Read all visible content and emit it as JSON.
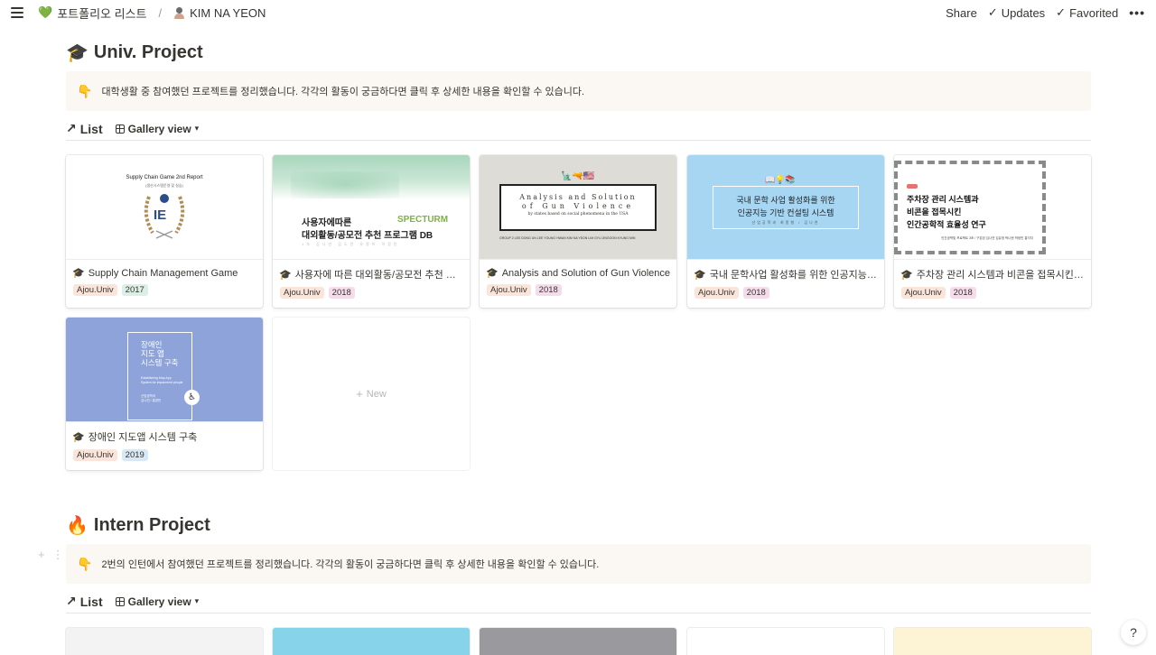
{
  "topbar": {
    "breadcrumb_1": "포트폴리오 리스트",
    "breadcrumb_2": "KIM NA YEON",
    "share": "Share",
    "updates": "Updates",
    "favorited": "Favorited",
    "more": "•••"
  },
  "sections": [
    {
      "emoji": "🎓",
      "title": "Univ. Project",
      "callout_emoji": "👇",
      "callout": "대학생활 중 참여했던 프로젝트를 정리했습니다. 각각의 활동이 궁금하다면 클릭 후 상세한 내용을 확인할 수 있습니다.",
      "view_link": "List",
      "view_type": "Gallery view"
    },
    {
      "emoji": "🔥",
      "title": "Intern Project",
      "callout_emoji": "👇",
      "callout": "2번의 인턴에서 참여했던 프로젝트를 정리했습니다. 각각의 활동이 궁금하다면 클릭 후 상세한 내용을 확인할 수 있습니다.",
      "view_link": "List",
      "view_type": "Gallery view"
    }
  ],
  "cards": [
    {
      "title": "Supply Chain Management Game",
      "tag": "Ajou.Univ",
      "year": "2017",
      "thumb": {
        "h": "Supply Chain Game 2nd Report",
        "s": "(생산시스템운영 및 실습)",
        "logo": "IE"
      }
    },
    {
      "title": "사용자에 따른 대외활동/공모전 추천 프로그램 DB",
      "tag": "Ajou.Univ",
      "year": "2018",
      "thumb": {
        "l1": "사용자에따른",
        "l2": "대외활동/공모전 추천 프로그램 DB",
        "brand": "SPECTURM",
        "sub": "1조  김나연  김도연  유정하  이정민"
      }
    },
    {
      "title": "Analysis and Solution of Gun Violence",
      "tag": "Ajou.Univ",
      "year": "2018",
      "thumb": {
        "a": "Analysis and Solution",
        "b": "of Gun Violence",
        "c": "by states based on social phenomena in the USA",
        "foot": "GROUP 2  LEE DONG UN  LEE YOUNG HWAN  KIM NA YEON  LIM GYU  JINGOON KYUNG MIN"
      }
    },
    {
      "title": "국내 문학사업 활성화를 위한 인공지능 기반 컨설팅 시스템",
      "tag": "Ajou.Univ",
      "year": "2018",
      "thumb": {
        "a": "국내 문학 사업 활성화를 위한",
        "b": "인공지능 기반 컨설팅 시스템",
        "c": "산업공학과  최종형 / 김나연"
      }
    },
    {
      "title": "주차장 관리 시스템과 비콘을 접목시킨 인간공학적 효율성 연구",
      "tag": "Ajou.Univ",
      "year": "2018",
      "thumb": {
        "a": "주차장 관리 시스템과",
        "b": "비콘을 접목시킨",
        "c": "인간공학적 효율성 연구",
        "d": "인간공학및 프로젝트 3조 / 구분된 김나연 김유정 박나현 박정민 홍석지"
      }
    },
    {
      "title": "장애인 지도앱 시스템 구축",
      "tag": "Ajou.Univ",
      "year": "2019",
      "thumb": {
        "a1": "장애인",
        "a2": "지도 앱",
        "a3": "시스템 구축",
        "b1": "Establishing Map App",
        "b2": "System for impairment people",
        "c1": "산업공학과",
        "c2": "김나연 / 홍경민",
        "wc": "♿"
      }
    }
  ],
  "new_label": "New",
  "help": "?"
}
